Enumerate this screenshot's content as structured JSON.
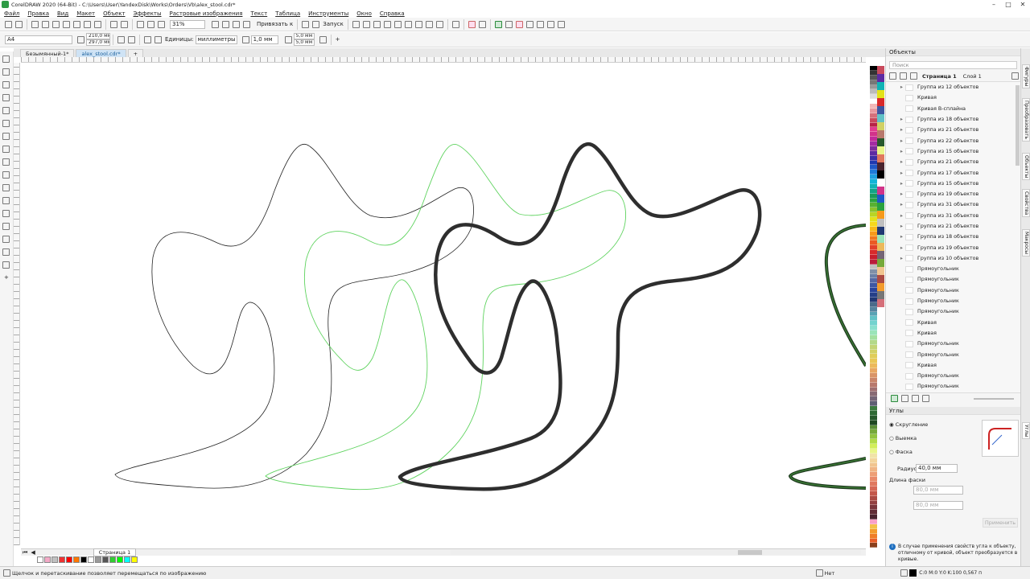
{
  "window": {
    "title": "CorelDRAW 2020 (64-Bit) - C:\\Users\\User\\YandexDisk\\Works\\Orders\\Vb\\alex_stool.cdr*"
  },
  "menu": [
    "Файл",
    "Правка",
    "Вид",
    "Макет",
    "Объект",
    "Эффекты",
    "Растровые изображения",
    "Текст",
    "Таблица",
    "Инструменты",
    "Окно",
    "Справка"
  ],
  "toolbar": {
    "zoom": "31%",
    "snap": "Привязать к",
    "launch": "Запуск"
  },
  "property_bar": {
    "page_size": "A4",
    "width": "210,0 мм",
    "height": "297,0 мм",
    "units_label": "Единицы:",
    "units": "миллиметры",
    "nudge": "1,0 мм",
    "dup_x": "5,0 мм",
    "dup_y": "5,0 мм"
  },
  "doc_tabs": [
    "Безымянный-1*",
    "alex_stool.cdr*"
  ],
  "page_tab": "Страница 1",
  "status": {
    "hint": "Щелчок и перетаскивание позволяет перемещаться по изображению",
    "fill": "Нет",
    "outline": "C:0 M:0 Y:0 K:100  0,567 п"
  },
  "objects": {
    "title": "Объекты",
    "search": "Поиск",
    "page": "Страница 1",
    "layer": "Слой 1",
    "items": [
      "Группа из 12 объектов",
      "Кривая",
      "Кривая B-сплайна",
      "Группа из 18 объектов",
      "Группа из 21 объектов",
      "Группа из 22 объектов",
      "Группа из 15 объектов",
      "Группа из 21 объектов",
      "Группа из 17 объектов",
      "Группа из 15 объектов",
      "Группа из 19 объектов",
      "Группа из 31 объектов",
      "Группа из 31 объектов",
      "Группа из 21 объектов",
      "Группа из 18 объектов",
      "Группа из 19 объектов",
      "Группа из 10 объектов",
      "Прямоугольник",
      "Прямоугольник",
      "Прямоугольник",
      "Прямоугольник",
      "Прямоугольник",
      "Кривая",
      "Кривая",
      "Прямоугольник",
      "Прямоугольник",
      "Кривая",
      "Прямоугольник",
      "Прямоугольник"
    ]
  },
  "corners": {
    "title": "Углы",
    "options": [
      "Скругление",
      "Выемка",
      "Фаска"
    ],
    "radius_label": "Радиус:",
    "radius": "40,0 мм",
    "chamfer_label": "Длина фаски",
    "chamfer_a": "80,0 мм",
    "chamfer_b": "80,0 мм",
    "apply": "Применить",
    "note": "В случае применения свойств угла к объекту, отличному от кривой, объект преобразуется в кривые."
  },
  "side_tabs": [
    "Фигуры",
    "Преобразовать",
    "Объекты",
    "Свойства",
    "Макросы"
  ],
  "side_tab_right": "Углы",
  "palette_colors": [
    "#000",
    "#333",
    "#555",
    "#777",
    "#999",
    "#bbb",
    "#ddd",
    "#fff",
    "#f2b8b8",
    "#e89aa0",
    "#d5707a",
    "#c94a5c",
    "#b82346",
    "#e23b8f",
    "#d2338a",
    "#c22a9a",
    "#a32ba2",
    "#7d2b9c",
    "#5d2ba2",
    "#3b2fa5",
    "#2038b0",
    "#1f58c7",
    "#1e7bd9",
    "#1ea0e0",
    "#13b5d9",
    "#11b3b5",
    "#13a388",
    "#1a9a59",
    "#2aa23f",
    "#58b031",
    "#8ac22c",
    "#b9d424",
    "#e3e21a",
    "#f7d81a",
    "#f8b818",
    "#f69a1b",
    "#f0781f",
    "#ea5a23",
    "#e2402a",
    "#d92a2b",
    "#c81e2e",
    "#b91b3a",
    "#c0c0c0",
    "#8090a8",
    "#6a7fa6",
    "#5569a6",
    "#3e57a2",
    "#2a449b",
    "#253f87",
    "#213873",
    "#4a6a8a",
    "#55839e",
    "#58a2b4",
    "#62c2c7",
    "#73d3cf",
    "#8ae0cf",
    "#9be4b9",
    "#a4e0a0",
    "#b3d98a",
    "#c3d476",
    "#d2d165",
    "#e0cd59",
    "#e9c756",
    "#ecb95b",
    "#e8a763",
    "#d99467",
    "#c9856a",
    "#b8786c",
    "#9f6f70",
    "#886a74",
    "#746576",
    "#5f5f74",
    "#3c7b3f",
    "#2f6a35",
    "#27592c",
    "#1f4823",
    "#5a8d36",
    "#76a93a",
    "#92c33f",
    "#b1db47",
    "#d2ee5a",
    "#e9f58a",
    "#f1e3a8",
    "#f3d59d",
    "#f1c590",
    "#f0b585",
    "#ee9f76",
    "#e98a6a",
    "#e0785f",
    "#d66755",
    "#c4584b",
    "#ac4b44",
    "#934041",
    "#7a363c",
    "#612d36",
    "#49242f",
    "#f8a0c8",
    "#f4c04a",
    "#f39c2e",
    "#ef7d27",
    "#e85e2a",
    "#8a3f1c"
  ],
  "doc_palette": [
    "#fff",
    "#f3a9c6",
    "#c0c0c0",
    "#e33",
    "#f00",
    "#f70",
    "#000",
    "#fff",
    "#999",
    "#555",
    "#3c3",
    "#0f0",
    "#0ff",
    "#ff0"
  ]
}
